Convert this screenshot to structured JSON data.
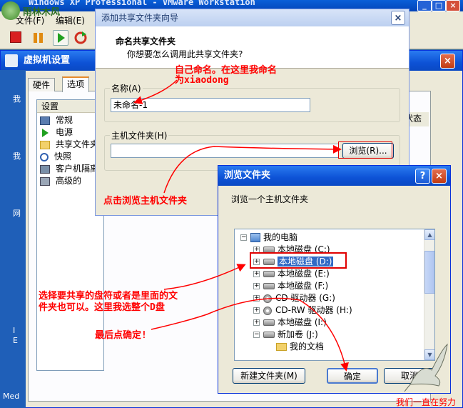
{
  "vmware": {
    "title": "Windows XP Professional - VMware Workstation",
    "menu": [
      "文件(F)",
      "编辑(E)"
    ],
    "logo_text": "雨林木风"
  },
  "settings": {
    "title": "虚拟机设置",
    "tabs": [
      "硬件",
      "选项"
    ],
    "list_header": "设置",
    "items": [
      "常规",
      "电源",
      "共享文件夹",
      "快照",
      "客户机隔离",
      "高级的"
    ],
    "right_header": "状态",
    "side_glyphs": [
      "我",
      "我",
      "网",
      "I",
      "E",
      "Med"
    ]
  },
  "wizard": {
    "title": "添加共享文件夹向导",
    "heading": "命名共享文件夹",
    "subheading": "你想要怎么调用此共享文件夹?",
    "name_label": "名称(A)",
    "name_value": "未命名-1",
    "host_label": "主机文件夹(H)",
    "host_value": "",
    "browse_button": "浏览(R)..."
  },
  "browse": {
    "title": "浏览文件夹",
    "prompt": "浏览一个主机文件夹",
    "tree": [
      {
        "label": "我的电脑",
        "icon": "computer-icon",
        "level": 0,
        "expand": "-"
      },
      {
        "label": "本地磁盘 (C:)",
        "icon": "drive-icon",
        "level": 1,
        "expand": "+"
      },
      {
        "label": "本地磁盘 (D:)",
        "icon": "drive-icon",
        "level": 1,
        "expand": "+",
        "selected": true
      },
      {
        "label": "本地磁盘 (E:)",
        "icon": "drive-icon",
        "level": 1,
        "expand": "+"
      },
      {
        "label": "本地磁盘 (F:)",
        "icon": "drive-icon",
        "level": 1,
        "expand": "+"
      },
      {
        "label": "CD 驱动器 (G:)",
        "icon": "cd-icon",
        "level": 1,
        "expand": "+"
      },
      {
        "label": "CD-RW 驱动器 (H:)",
        "icon": "cd-icon",
        "level": 1,
        "expand": "+"
      },
      {
        "label": "本地磁盘 (I:)",
        "icon": "drive-icon",
        "level": 1,
        "expand": "+"
      },
      {
        "label": "新加卷 (J:)",
        "icon": "drive-icon",
        "level": 1,
        "expand": "-"
      },
      {
        "label": "我的文档",
        "icon": "folder-icon",
        "level": 2,
        "expand": ""
      }
    ],
    "new_folder_button": "新建文件夹(M)",
    "ok_button": "确定",
    "cancel_button": "取消"
  },
  "annotations": {
    "name_note_1": "自己命名。在这里我命名",
    "name_note_2": "为xiaodong",
    "browse_note": "点击浏览主机文件夹",
    "select_note_1": "选择要共享的盘符或者是里面的文",
    "select_note_2": "件夹也可以。这里我选整个D盘",
    "ok_note": "最后点确定!",
    "signature": "我们一直在努力"
  },
  "colors": {
    "annotation": "#ff0000",
    "xp_title_blue": "#0a49c4",
    "selection": "#316ac5"
  }
}
